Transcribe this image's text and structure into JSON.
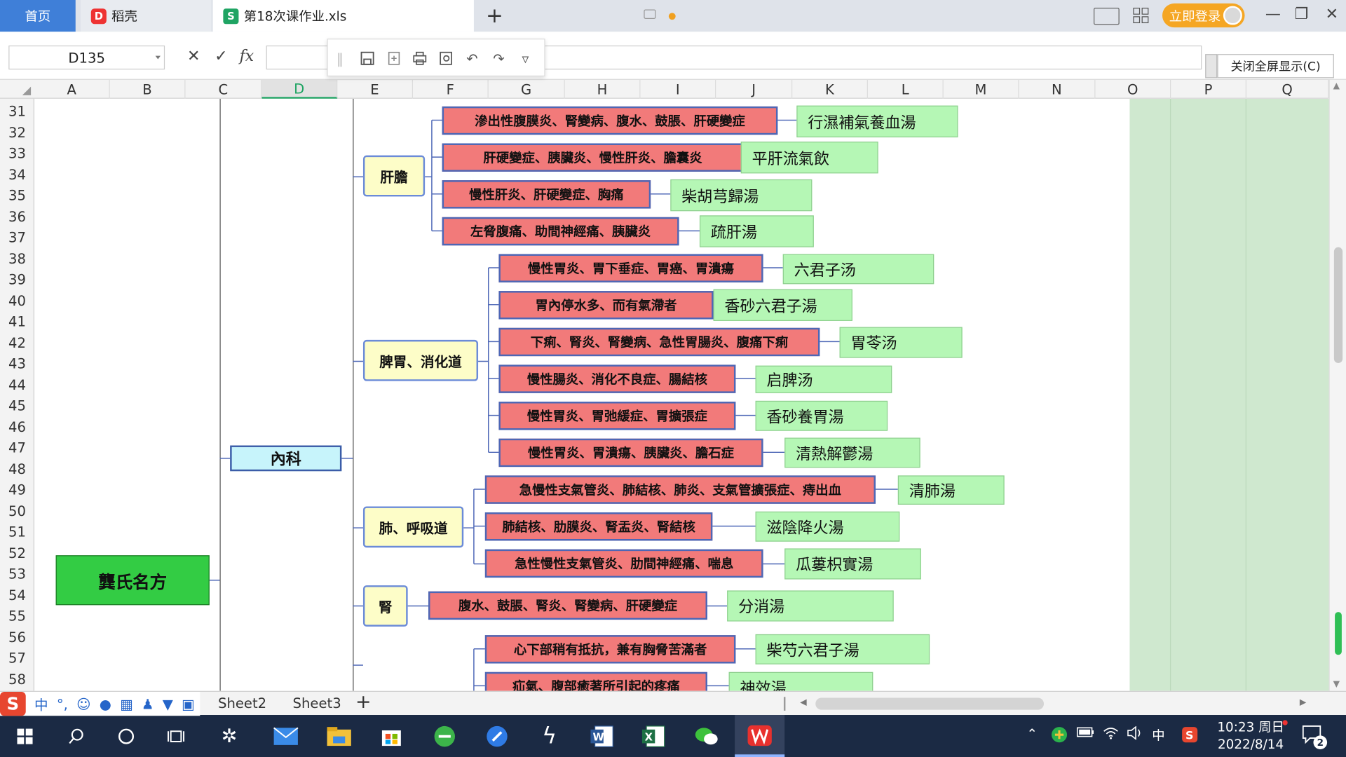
{
  "tabs": {
    "home": "首页",
    "wps": "稻壳",
    "file": "第18次课作业.xls",
    "login": "立即登录"
  },
  "formula_bar": {
    "name_box": "D135",
    "fx": "fx",
    "close_fullscreen": "关闭全屏显示(C)"
  },
  "columns": [
    "A",
    "B",
    "C",
    "D",
    "E",
    "F",
    "G",
    "H",
    "I",
    "J",
    "K",
    "L",
    "M",
    "N",
    "O",
    "P",
    "Q"
  ],
  "rows": [
    "31",
    "32",
    "33",
    "34",
    "35",
    "36",
    "37",
    "38",
    "39",
    "40",
    "41",
    "42",
    "43",
    "44",
    "45",
    "46",
    "47",
    "48",
    "49",
    "50",
    "51",
    "52",
    "53",
    "54",
    "55",
    "56",
    "57",
    "58"
  ],
  "mindmap": {
    "root": "龔氏名方",
    "l1": "內科",
    "groups": [
      {
        "label": "肝膽",
        "items": [
          {
            "disease": "滲出性腹膜炎、腎變病、腹水、鼓脹、肝硬變症",
            "formula": "行濕補氣養血湯"
          },
          {
            "disease": "肝硬變症、胰臟炎、慢性肝炎、膽囊炎",
            "formula": "平肝流氣飲"
          },
          {
            "disease": "慢性肝炎、肝硬變症、胸痛",
            "formula": "柴胡芎歸湯"
          },
          {
            "disease": "左脅腹痛、助間神經痛、胰臟炎",
            "formula": "疏肝湯"
          }
        ]
      },
      {
        "label": "脾胃、消化道",
        "items": [
          {
            "disease": "慢性胃炎、胃下垂症、胃癌、胃潰瘍",
            "formula": "六君子汤"
          },
          {
            "disease": "胃內停水多、而有氣滯者",
            "formula": "香砂六君子湯"
          },
          {
            "disease": "下痢、腎炎、腎變病、急性胃腸炎、腹痛下痢",
            "formula": "胃苓汤"
          },
          {
            "disease": "慢性腸炎、消化不良症、腸結核",
            "formula": "启脾汤"
          },
          {
            "disease": "慢性胃炎、胃弛緩症、胃擴張症",
            "formula": "香砂養胃湯"
          },
          {
            "disease": "慢性胃炎、胃潰瘍、胰臟炎、膽石症",
            "formula": "清熱解鬱湯"
          }
        ]
      },
      {
        "label": "肺、呼吸道",
        "items": [
          {
            "disease": "急慢性支氣管炎、肺結核、肺炎、支氣管擴張症、痔出血",
            "formula": "清肺湯"
          },
          {
            "disease": "肺結核、肋膜炎、腎盂炎、腎結核",
            "formula": "滋陰降火湯"
          },
          {
            "disease": "急性慢性支氣管炎、肋間神經痛、喘息",
            "formula": "瓜蔞枳實湯"
          }
        ]
      },
      {
        "label": "腎",
        "items": [
          {
            "disease": "腹水、鼓脹、腎炎、腎變病、肝硬變症",
            "formula": "分消湯"
          }
        ]
      },
      {
        "label": "",
        "items": [
          {
            "disease": "心下部稍有抵抗，兼有胸脅苦滿者",
            "formula": "柴芍六君子湯"
          },
          {
            "disease": "疝氣、腹部癒著所引起的疼痛",
            "formula": "神效湯"
          }
        ]
      }
    ]
  },
  "sheets": [
    "Sheet2",
    "Sheet3"
  ],
  "ime": {
    "mode": "中",
    "punct": "°,"
  },
  "taskbar": {
    "time": "10:23 周日",
    "date": "2022/8/14",
    "lang": "中",
    "notifications": "2"
  },
  "colors": {
    "accent": "#1fa463",
    "tab_home": "#3f7fd8",
    "login": "#f5a623"
  }
}
